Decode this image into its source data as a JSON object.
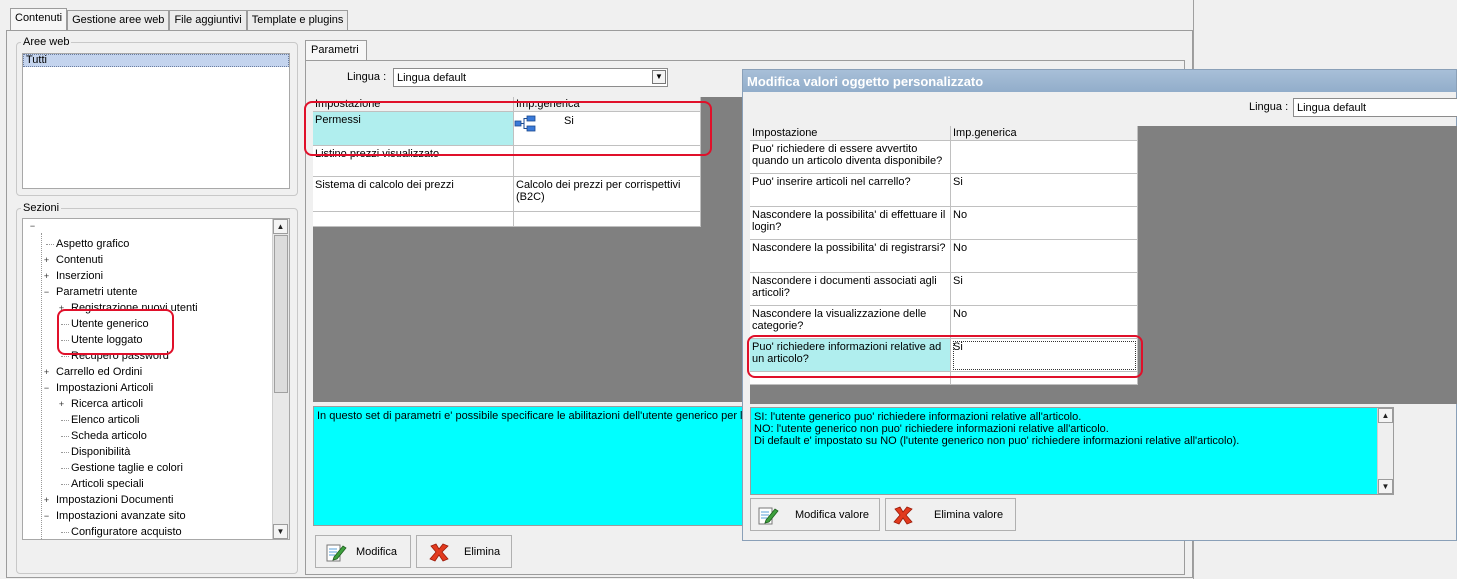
{
  "tabs": [
    "Contenuti",
    "Gestione aree web",
    "File aggiuntivi",
    "Template e plugins"
  ],
  "aree_web": {
    "legend": "Aree web",
    "items": [
      "Tutti"
    ]
  },
  "sezioni": {
    "legend": "Sezioni",
    "tree": [
      {
        "label": "Aspetto grafico",
        "level": 1,
        "expander": ""
      },
      {
        "label": "Contenuti",
        "level": 1,
        "expander": "+"
      },
      {
        "label": "Inserzioni",
        "level": 1,
        "expander": "+"
      },
      {
        "label": "Parametri utente",
        "level": 1,
        "expander": "−"
      },
      {
        "label": "Registrazione nuovi utenti",
        "level": 2,
        "expander": "+"
      },
      {
        "label": "Utente generico",
        "level": 2,
        "expander": ""
      },
      {
        "label": "Utente loggato",
        "level": 2,
        "expander": ""
      },
      {
        "label": "Recupero password",
        "level": 2,
        "expander": ""
      },
      {
        "label": "Carrello ed Ordini",
        "level": 1,
        "expander": "+"
      },
      {
        "label": "Impostazioni Articoli",
        "level": 1,
        "expander": "−"
      },
      {
        "label": "Ricerca articoli",
        "level": 2,
        "expander": "+"
      },
      {
        "label": "Elenco articoli",
        "level": 2,
        "expander": ""
      },
      {
        "label": "Scheda articolo",
        "level": 2,
        "expander": ""
      },
      {
        "label": "Disponibilità",
        "level": 2,
        "expander": ""
      },
      {
        "label": "Gestione taglie e colori",
        "level": 2,
        "expander": ""
      },
      {
        "label": "Articoli speciali",
        "level": 2,
        "expander": ""
      },
      {
        "label": "Impostazioni Documenti",
        "level": 1,
        "expander": "+"
      },
      {
        "label": "Impostazioni avanzate sito",
        "level": 1,
        "expander": "−"
      },
      {
        "label": "Configuratore acquisto",
        "level": 2,
        "expander": ""
      }
    ]
  },
  "parametri": {
    "tab": "Parametri",
    "lingua_label": "Lingua :",
    "lingua_value": "Lingua default",
    "headers": [
      "Impostazione",
      "Imp.generica"
    ],
    "rows": [
      {
        "name": "Permessi",
        "value": "Si"
      },
      {
        "name": "Listino prezzi visualizzato",
        "value": ""
      },
      {
        "name": "Sistema di calcolo dei prezzi",
        "value": "Calcolo dei prezzi per corrispettivi (B2C)"
      },
      {
        "name": "",
        "value": ""
      }
    ],
    "description": "In questo set di parametri e' possibile specificare le abilitazioni dell'utente generico per la",
    "buttons": {
      "modifica": "Modifica",
      "elimina": "Elimina"
    }
  },
  "dialog": {
    "title": "Modifica valori oggetto personalizzato",
    "lingua_label": "Lingua :",
    "lingua_value": "Lingua default",
    "headers": [
      "Impostazione",
      "Imp.generica"
    ],
    "rows": [
      {
        "name": "Puo' richiedere di essere avvertito quando un articolo diventa disponibile?",
        "value": ""
      },
      {
        "name": "Puo' inserire articoli nel carrello?",
        "value": "Si"
      },
      {
        "name": "Nascondere la possibilita' di effettuare il login?",
        "value": "No"
      },
      {
        "name": "Nascondere la possibilita' di registrarsi?",
        "value": "No"
      },
      {
        "name": "Nascondere i documenti associati agli articoli?",
        "value": "Si"
      },
      {
        "name": "Nascondere la visualizzazione delle categorie?",
        "value": "No"
      },
      {
        "name": "Puo' richiedere informazioni relative ad un articolo?",
        "value": "Si"
      },
      {
        "name": "",
        "value": ""
      }
    ],
    "description_lines": [
      "SI: l'utente generico puo' richiedere informazioni relative all'articolo.",
      "NO: l'utente generico non puo' richiedere informazioni relative all'articolo.",
      "Di default e' impostato su NO (l'utente generico non puo' richiedere informazioni relative all'articolo)."
    ],
    "buttons": {
      "modifica": "Modifica valore",
      "elimina": "Elimina valore"
    }
  },
  "colors": {
    "cyan": "#00ffff",
    "selected_row": "#b0eeee",
    "highlight": "#e0102a",
    "dark_bg": "#808080"
  }
}
